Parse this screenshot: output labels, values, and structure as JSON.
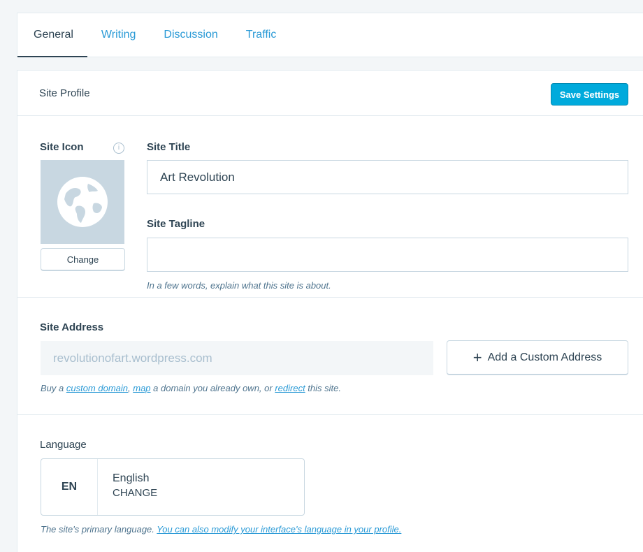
{
  "tabs": [
    {
      "label": "General",
      "active": true
    },
    {
      "label": "Writing"
    },
    {
      "label": "Discussion"
    },
    {
      "label": "Traffic"
    }
  ],
  "card": {
    "title": "Site Profile",
    "save_label": "Save Settings"
  },
  "site_icon": {
    "label": "Site Icon",
    "info_glyph": "i",
    "change_label": "Change"
  },
  "site_title": {
    "label": "Site Title",
    "value": "Art Revolution"
  },
  "site_tagline": {
    "label": "Site Tagline",
    "value": "",
    "hint": "In a few words, explain what this site is about."
  },
  "site_address": {
    "label": "Site Address",
    "value": "revolutionofart.wordpress.com",
    "add_button_icon": "+",
    "add_button_label": "Add a Custom Address",
    "hint_prefix": "Buy a ",
    "link_custom_domain": "custom domain",
    "hint_sep1": ", ",
    "link_map": "map",
    "hint_mid": " a domain you already own, or ",
    "link_redirect": "redirect",
    "hint_suffix": " this site."
  },
  "language": {
    "label": "Language",
    "code": "EN",
    "name": "English",
    "change_label": "CHANGE",
    "hint_text": "The site's primary language. ",
    "hint_link": "You can also modify your interface's language in your profile."
  },
  "colors": {
    "accent": "#00aadc",
    "link": "#2a9ad6",
    "text": "#2e4453",
    "border": "#c8d7e1",
    "icon_bg": "#c8d7e1"
  },
  "icons": {
    "info": "info-icon",
    "globe": "globe-icon",
    "plus": "plus-icon"
  }
}
